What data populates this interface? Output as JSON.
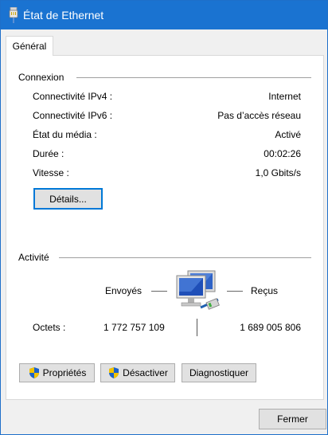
{
  "window": {
    "title": "État de Ethernet"
  },
  "tabs": [
    {
      "label": "Général"
    }
  ],
  "connexion": {
    "heading": "Connexion",
    "rows": [
      {
        "label": "Connectivité IPv4 :",
        "value": "Internet"
      },
      {
        "label": "Connectivité IPv6 :",
        "value": "Pas d’accès réseau"
      },
      {
        "label": "État du média :",
        "value": "Activé"
      },
      {
        "label": "Durée :",
        "value": "00:02:26"
      },
      {
        "label": "Vitesse :",
        "value": "1,0 Gbits/s"
      }
    ],
    "details_button": "Détails..."
  },
  "activite": {
    "heading": "Activité",
    "sent_label": "Envoyés",
    "received_label": "Reçus",
    "octets_label": "Octets :",
    "octets_sent": "1 772 757 109",
    "octets_received": "1 689 005 806"
  },
  "buttons": {
    "proprietes": "Propriétés",
    "desactiver": "Désactiver",
    "diagnostiquer": "Diagnostiquer",
    "fermer": "Fermer"
  },
  "colors": {
    "titlebar": "#1a73d1",
    "focus": "#0078d7"
  },
  "icons": {
    "title": "ethernet-plug-icon",
    "network": "network-computers-icon",
    "shield": "uac-shield-icon"
  }
}
